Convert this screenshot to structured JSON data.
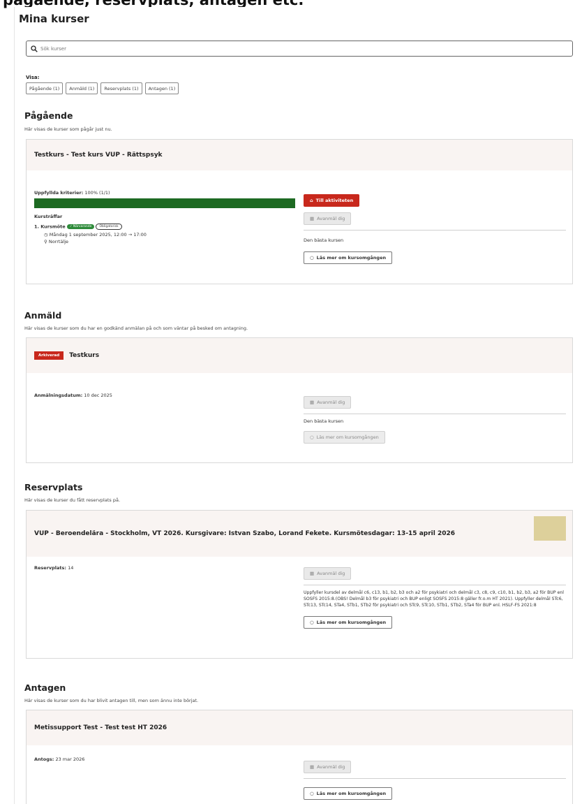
{
  "top_caption": "pågående, reservplats, antagen etc.",
  "page_title": "Mina kurser",
  "search": {
    "placeholder": "Sök kurser"
  },
  "filters": {
    "label": "Visa:",
    "items": [
      "Pågående (1)",
      "Anmäld (1)",
      "Reservplats (1)",
      "Antagen (1)"
    ]
  },
  "ongoing": {
    "title": "Pågående",
    "description": "Här visas de kurser som pågår just nu.",
    "course_title": "Testkurs - Test kurs VUP - Rättspsyk",
    "criteria_label": "Uppfyllda kriterier:",
    "criteria_value": "100% (1/1)",
    "progress": 1.0,
    "meetings_label": "Kursträffar",
    "meeting_item": "1. Kursmöte",
    "badge_present": "✓ Närvarande",
    "badge_mandatory": "Obligatorisk",
    "meeting_time": "Måndag 1 september 2025, 12:00 → 17:00",
    "meeting_place": "Norrtälje",
    "btn_activity": "Till aktiviteten",
    "btn_unregister": "Avanmäl dig",
    "course_desc": "Den bästa kursen",
    "btn_read_more": "Läs mer om kursomgången"
  },
  "registered": {
    "title": "Anmäld",
    "description": "Här visas de kurser som du har en godkänd anmälan på och som väntar på besked om antagning.",
    "badge_archived": "Arkiverad",
    "course_title": "Testkurs",
    "date_label": "Anmälningsdatum:",
    "date_value": "10 dec 2025",
    "btn_unregister": "Avanmäl dig",
    "course_desc": "Den bästa kursen",
    "btn_read_more": "Läs mer om kursomgången"
  },
  "reserve": {
    "title": "Reservplats",
    "description": "Här visas de kurser du fått reservplats på.",
    "course_title": "VUP - Beroendelära - Stockholm, VT 2026. Kursgivare: Istvan Szabo, Lorand Fekete. Kursmötesdagar: 13-15 april 2026",
    "swatch_color": "#ddd09b",
    "reserve_label": "Reservplats:",
    "reserve_value": "14",
    "btn_unregister": "Avanmäl dig",
    "course_desc": "Uppfyller kursdel av delmål c6, c13, b1, b2, b3 och a2 för psykiatri och delmål c3, c8, c9, c10, b1, b2, b3, a2 för BUP enl SOSFS 2015:8.(OBS! Delmål b3 för psykiatri och BUP enligt SOSFS 2015:8 gäller fr.o.m HT 2021). Uppfyller delmål STc6, STc13, STc14, STa4, STb1, STb2 för psykiatri och STc9, STc10, STb1, STb2, STa4 för BUP enl. HSLF-FS 2021:8",
    "btn_read_more": "Läs mer om kursomgången"
  },
  "admitted": {
    "title": "Antagen",
    "description": "Här visas de kurser som du har blivit antagen till, men som ännu inte börjat.",
    "course_title": "Metissupport Test - Test test HT 2026",
    "admitted_label": "Antogs:",
    "admitted_value": "23 mar 2026",
    "btn_unregister": "Avanmäl dig",
    "btn_read_more": "Läs mer om kursomgången"
  },
  "colors": {
    "accent_red": "#c8281c",
    "progress_green": "#1d6a22",
    "card_header_bg": "#f9f4f2"
  }
}
